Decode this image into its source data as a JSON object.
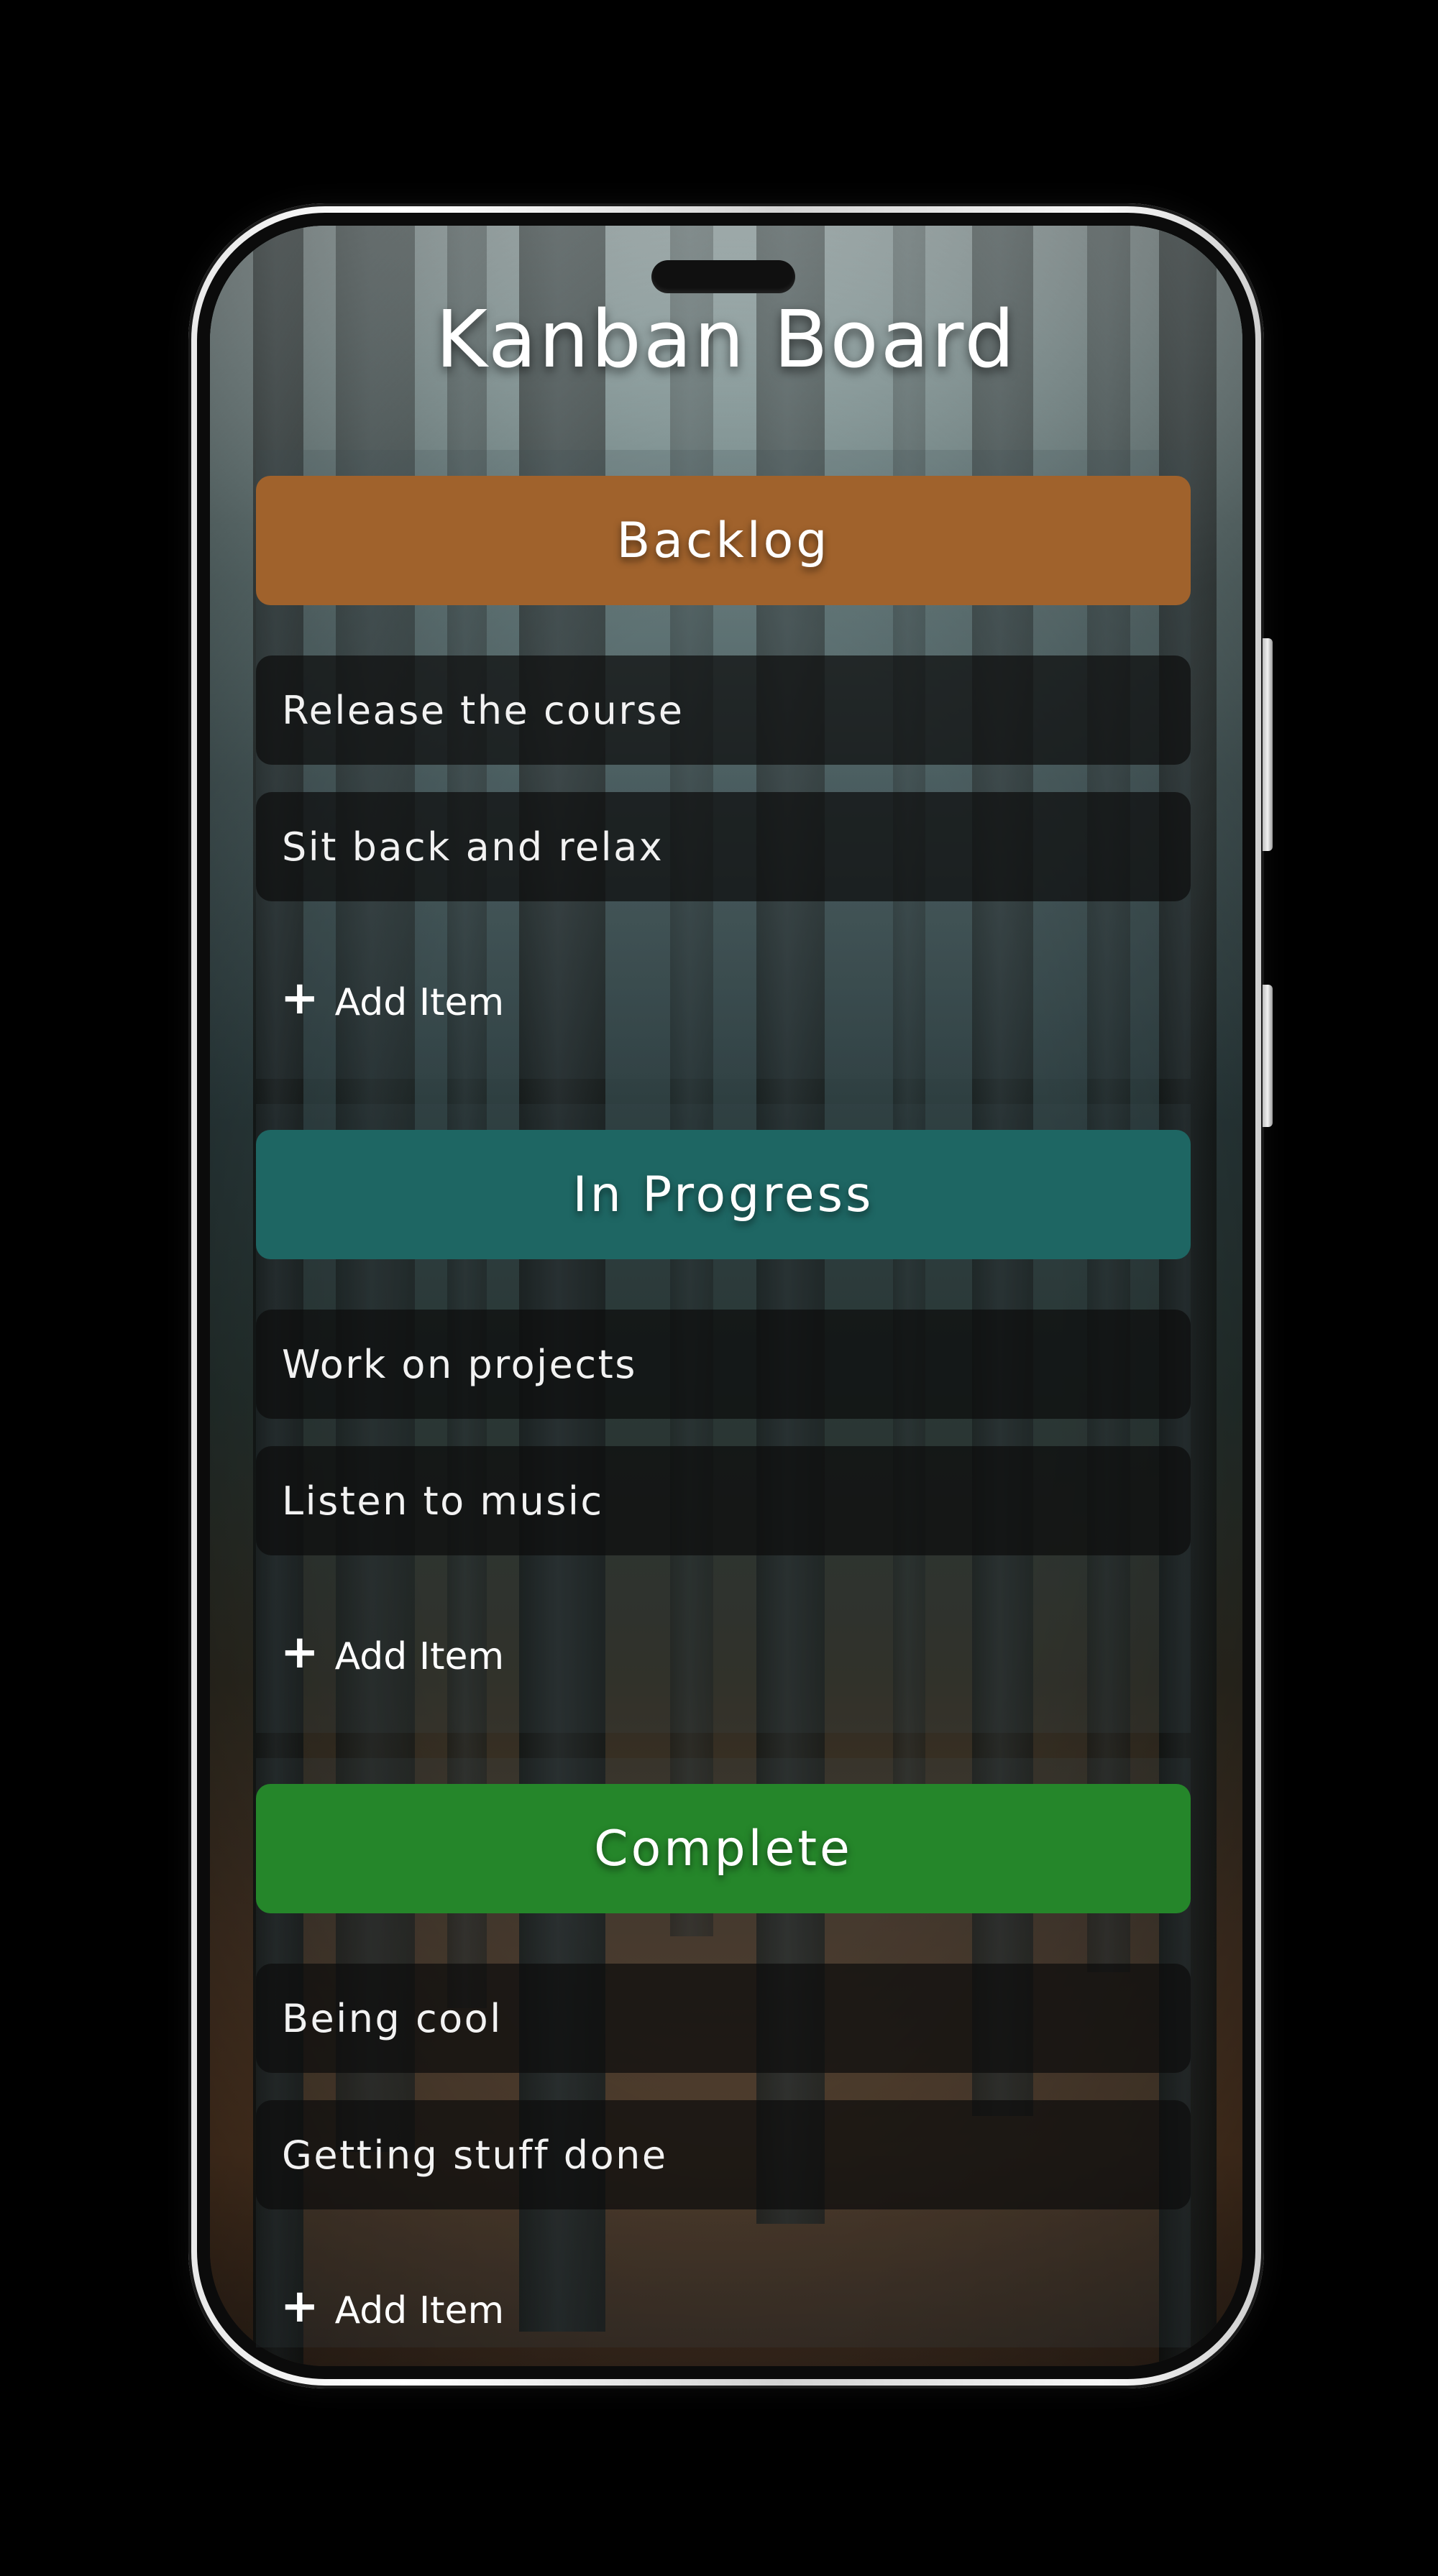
{
  "app": {
    "title": "Kanban Board"
  },
  "colors": {
    "backlog": "#A0622C",
    "in_progress": "#1E6663",
    "complete": "#25862A",
    "card_bg": "rgba(12,12,12,0.72)",
    "text": "#FFFFFF"
  },
  "columns": [
    {
      "name": "Backlog",
      "items": [
        "Release the course",
        "Sit back and relax"
      ],
      "add_label": "Add Item",
      "add_icon": "plus-icon"
    },
    {
      "name": "In Progress",
      "items": [
        "Work on projects",
        "Listen to music"
      ],
      "add_label": "Add Item",
      "add_icon": "plus-icon"
    },
    {
      "name": "Complete",
      "items": [
        "Being cool",
        "Getting stuff done"
      ],
      "add_label": "Add Item",
      "add_icon": "plus-icon"
    }
  ]
}
